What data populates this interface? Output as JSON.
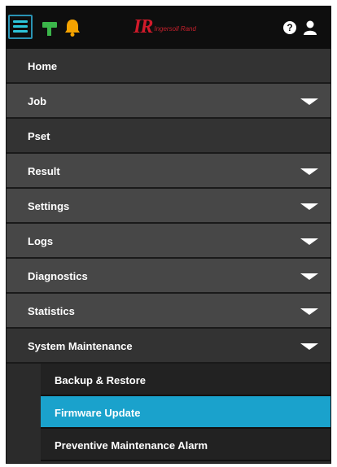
{
  "header": {
    "logo_mark": "IR",
    "logo_text": "Ingersoll Rand",
    "help_glyph": "?",
    "icons": [
      "menu-icon",
      "tool-icon",
      "bell-icon",
      "help-icon",
      "user-icon"
    ]
  },
  "menu": {
    "items": [
      {
        "label": "Home"
      },
      {
        "label": "Job"
      },
      {
        "label": "Pset"
      },
      {
        "label": "Result"
      },
      {
        "label": "Settings"
      },
      {
        "label": "Logs"
      },
      {
        "label": "Diagnostics"
      },
      {
        "label": "Statistics"
      },
      {
        "label": "System Maintenance"
      }
    ],
    "subitems": [
      {
        "label": "Backup & Restore"
      },
      {
        "label": "Firmware Update"
      },
      {
        "label": "Preventive Maintenance Alarm"
      }
    ],
    "active_subitem": "Firmware Update"
  },
  "colors": {
    "accent": "#1aa2cc",
    "brand": "#d11a2a",
    "bell": "#f5a300",
    "tool": "#3bb54a"
  }
}
